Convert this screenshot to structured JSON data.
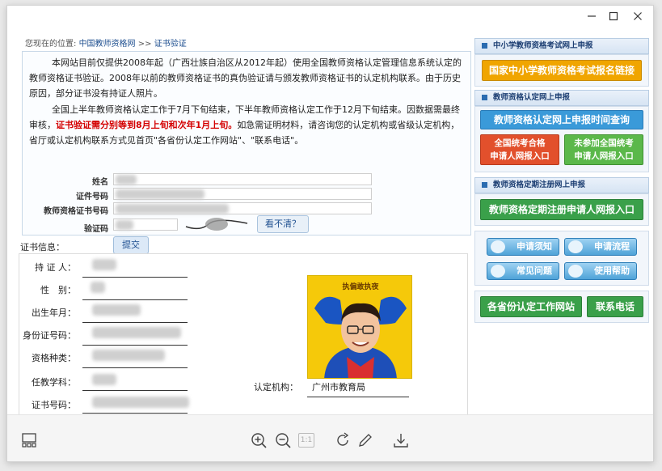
{
  "window": {
    "controls": {
      "minimize_icon": "minimize-icon",
      "maximize_icon": "maximize-icon",
      "close_icon": "close-icon"
    }
  },
  "page": {
    "breadcrumb": {
      "prefix": "您现在的位置:",
      "home": "中国教师资格网",
      "separator": ">>",
      "current": "证书验证"
    },
    "intro_p1": "本网站目前仅提供2008年起（广西壮族自治区从2012年起）使用全国教师资格认定管理信息系统认定的教师资格证书验证。2008年以前的教师资格证书的真伪验证请与颁发教师资格证书的认定机构联系。由于历史原因，部分证书没有持证人照片。",
    "intro_p2_a": "全国上半年教师资格认定工作于7月下旬结束，下半年教师资格认定工作于12月下旬结束。因数据需最终审核，",
    "intro_p2_red": "证书验证需分别等到8月上旬和次年1月上旬。",
    "intro_p2_b": "如急需证明材料，请咨询您的认定机构或省级认定机构，省厅或认定机构联系方式见首页\"各省份认定工作网站\"、\"联系电话\"。",
    "form": {
      "name_label": "姓名",
      "cert_no_label": "证件号码",
      "teacher_cert_label": "教师资格证书号码",
      "captcha_label": "验证码",
      "unclear_button": "看不清？",
      "submit_button": "提交"
    },
    "cert_info": {
      "title": "证书信息：",
      "holder_label": "持 证 人：",
      "gender_label": "性　别：",
      "birth_label": "出生年月：",
      "id_label": "身份证号码：",
      "type_label": "资格种类：",
      "subject_label": "任教学科：",
      "cert_no_label": "证书号码：",
      "authority_label": "认定机构：",
      "authority_value": "广州市教育局",
      "photo_caption": "执偏敢执夜"
    },
    "sidebar": {
      "section1_title": "中小学教师资格考试网上申报",
      "exam_link": "国家中小学教师资格考试报名链接",
      "section2_title": "教师资格认定网上申报",
      "time_query": "教师资格认定网上申报时间查询",
      "passed_line1": "全国统考合格",
      "passed_line2": "申请人网报入口",
      "notpassed_line1": "未参加全国统考",
      "notpassed_line2": "申请人网报入口",
      "section3_title": "教师资格定期注册网上申报",
      "registration": "教师资格定期注册申请人网报入口",
      "notice": "申请须知",
      "process": "申请流程",
      "faq": "常见问题",
      "help": "使用帮助",
      "province_sites": "各省份认定工作网站",
      "contact": "联系电话"
    }
  },
  "viewer_toolbar": {
    "icons": [
      "gallery-icon",
      "zoom-in-icon",
      "zoom-out-icon",
      "actual-size-icon",
      "rotate-icon",
      "edit-icon",
      "download-icon"
    ],
    "actual_size_label": "1:1"
  },
  "colors": {
    "link_blue": "#1d4e8f",
    "warning_red": "#d40000",
    "exam_link_bg": "#f0a500",
    "time_query_bg": "#3a9ad9",
    "passed_bg": "#e2502c",
    "notpassed_bg": "#5bb84a",
    "registration_bg": "#3aa04a"
  }
}
